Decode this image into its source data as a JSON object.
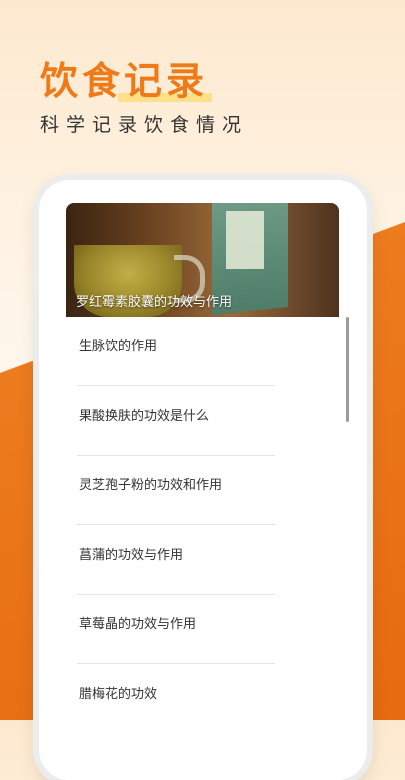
{
  "promo": {
    "headline": "饮食记录",
    "subline": "科学记录饮食情况"
  },
  "hero": {
    "title": "罗红霉素胶囊的功效与作用"
  },
  "articles": [
    {
      "title": "生脉饮的作用"
    },
    {
      "title": "果酸换肤的功效是什么"
    },
    {
      "title": "灵芝孢子粉的功效和作用"
    },
    {
      "title": "菖蒲的功效与作用"
    },
    {
      "title": "草莓晶的功效与作用"
    },
    {
      "title": "腊梅花的功效"
    }
  ],
  "colors": {
    "accent": "#ef7a18",
    "band": "#e66a10"
  }
}
